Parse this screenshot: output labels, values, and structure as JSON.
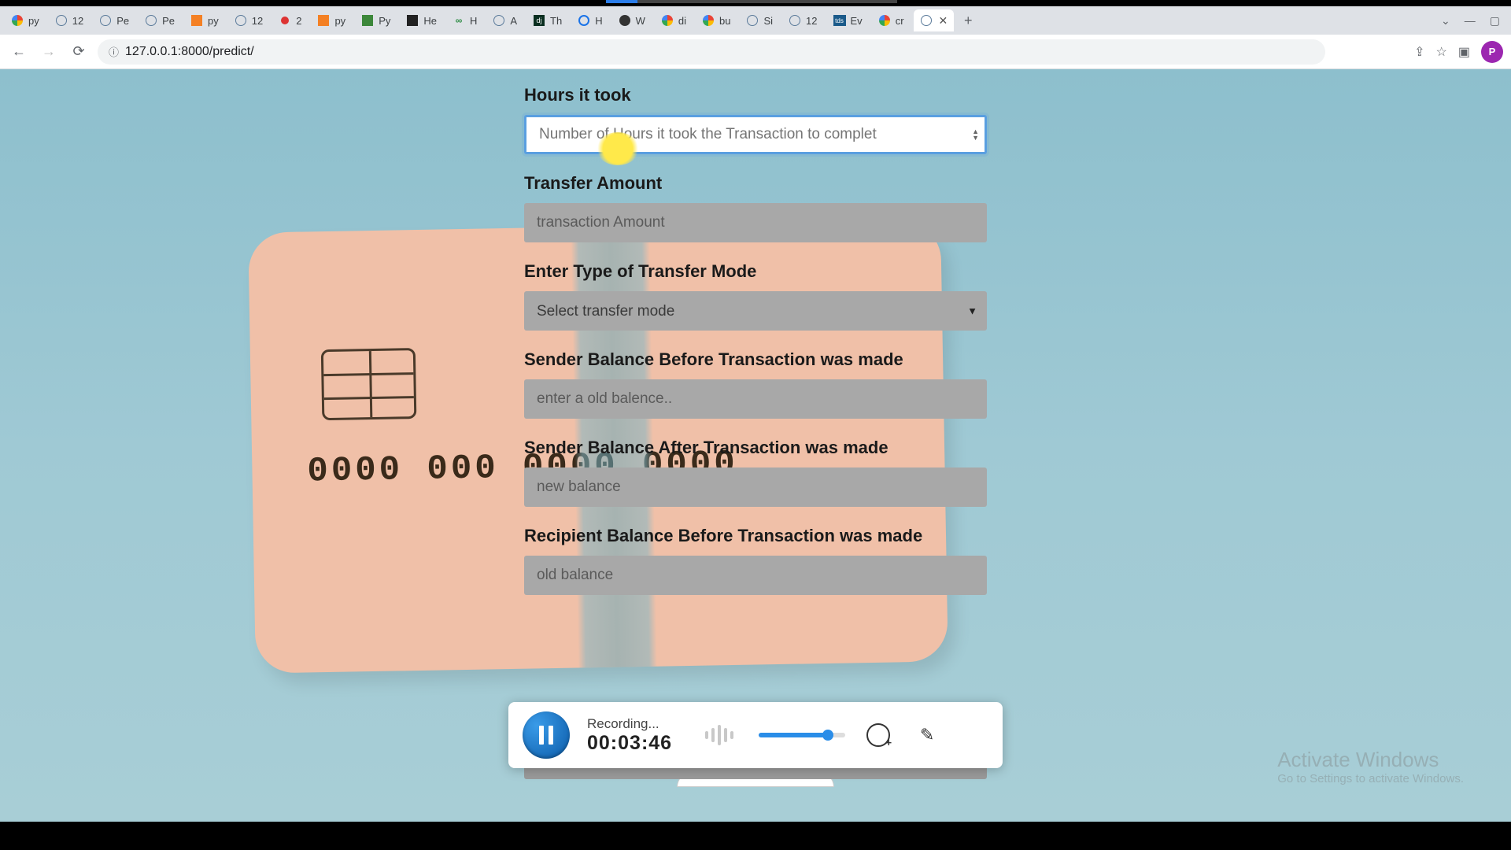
{
  "browser": {
    "tabs": [
      {
        "fav": "g",
        "label": "py"
      },
      {
        "fav": "globe",
        "label": "12"
      },
      {
        "fav": "globe",
        "label": "Pe"
      },
      {
        "fav": "globe",
        "label": "Pe"
      },
      {
        "fav": "so",
        "label": "py"
      },
      {
        "fav": "globe",
        "label": "12"
      },
      {
        "fav": "red",
        "label": "2"
      },
      {
        "fav": "so",
        "label": "py"
      },
      {
        "fav": "green",
        "label": "Py"
      },
      {
        "fav": "dark",
        "label": "He"
      },
      {
        "fav": "gfg",
        "label": "H"
      },
      {
        "fav": "globe",
        "label": "A"
      },
      {
        "fav": "dj",
        "label": "Th"
      },
      {
        "fav": "blue",
        "label": "H"
      },
      {
        "fav": "w",
        "label": "W"
      },
      {
        "fav": "g",
        "label": "di"
      },
      {
        "fav": "g",
        "label": "bu"
      },
      {
        "fav": "globe",
        "label": "Si"
      },
      {
        "fav": "globe",
        "label": "12"
      },
      {
        "fav": "tds",
        "label": "Ev"
      },
      {
        "fav": "g",
        "label": "cr"
      }
    ],
    "active_tab_label": "",
    "url": "127.0.0.1:8000/predict/",
    "profile_initial": "P"
  },
  "form": {
    "hours_label": "Hours it took",
    "hours_placeholder": "Number of Hours it took the Transaction to complet",
    "amount_label": "Transfer Amount",
    "amount_placeholder": "transaction Amount",
    "mode_label": "Enter Type of Transfer Mode",
    "mode_placeholder": "Select transfer mode",
    "sender_before_label": "Sender Balance Before Transaction was made",
    "sender_before_placeholder": "enter a old balence..",
    "sender_after_label": "Sender Balance After Transaction was made",
    "sender_after_placeholder": "new balance",
    "recipient_before_label": "Recipient Balance Before Transaction was made",
    "recipient_before_placeholder": "old balance"
  },
  "card": {
    "number": "0000  000  0000  0000"
  },
  "recorder": {
    "status": "Recording...",
    "time": "00:03:46"
  },
  "watermark": {
    "line1": "Activate Windows",
    "line2": "Go to Settings to activate Windows."
  }
}
